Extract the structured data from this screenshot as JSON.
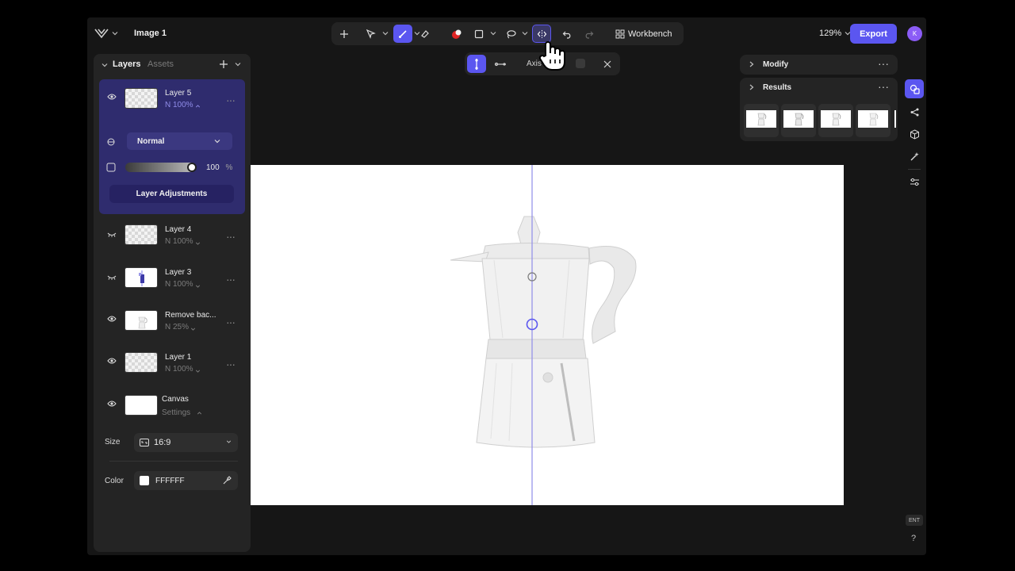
{
  "header": {
    "doc_title": "Image 1",
    "workbench_label": "Workbench",
    "zoom": "129%",
    "export_label": "Export",
    "avatar_initial": "K"
  },
  "subtoolbar": {
    "label": "Axis ...ing"
  },
  "left_panel": {
    "tab_layers": "Layers",
    "tab_assets": "Assets",
    "layers": [
      {
        "name": "Layer 5",
        "sub": "N 100%",
        "visible": true,
        "selected": true
      },
      {
        "name": "Layer 4",
        "sub": "N 100%",
        "visible": false
      },
      {
        "name": "Layer 3",
        "sub": "N 100%",
        "visible": false
      },
      {
        "name": "Remove bac...",
        "sub": "N 25%",
        "visible": true
      },
      {
        "name": "Layer 1",
        "sub": "N 100%",
        "visible": true
      }
    ],
    "canvas_layer": {
      "name": "Canvas",
      "sub": "Settings"
    },
    "blend_mode": "Normal",
    "opacity_value": "100",
    "opacity_unit": "%",
    "adjustments_label": "Layer Adjustments",
    "size_label": "Size",
    "size_value": "16:9",
    "color_label": "Color",
    "color_value": "FFFFFF"
  },
  "right_panel": {
    "modify_label": "Modify",
    "results_label": "Results"
  },
  "rail": {
    "ent_label": "ENT",
    "help_label": "?"
  },
  "colors": {
    "accent": "#5b56f0",
    "panel": "#242424",
    "background": "#161616"
  }
}
